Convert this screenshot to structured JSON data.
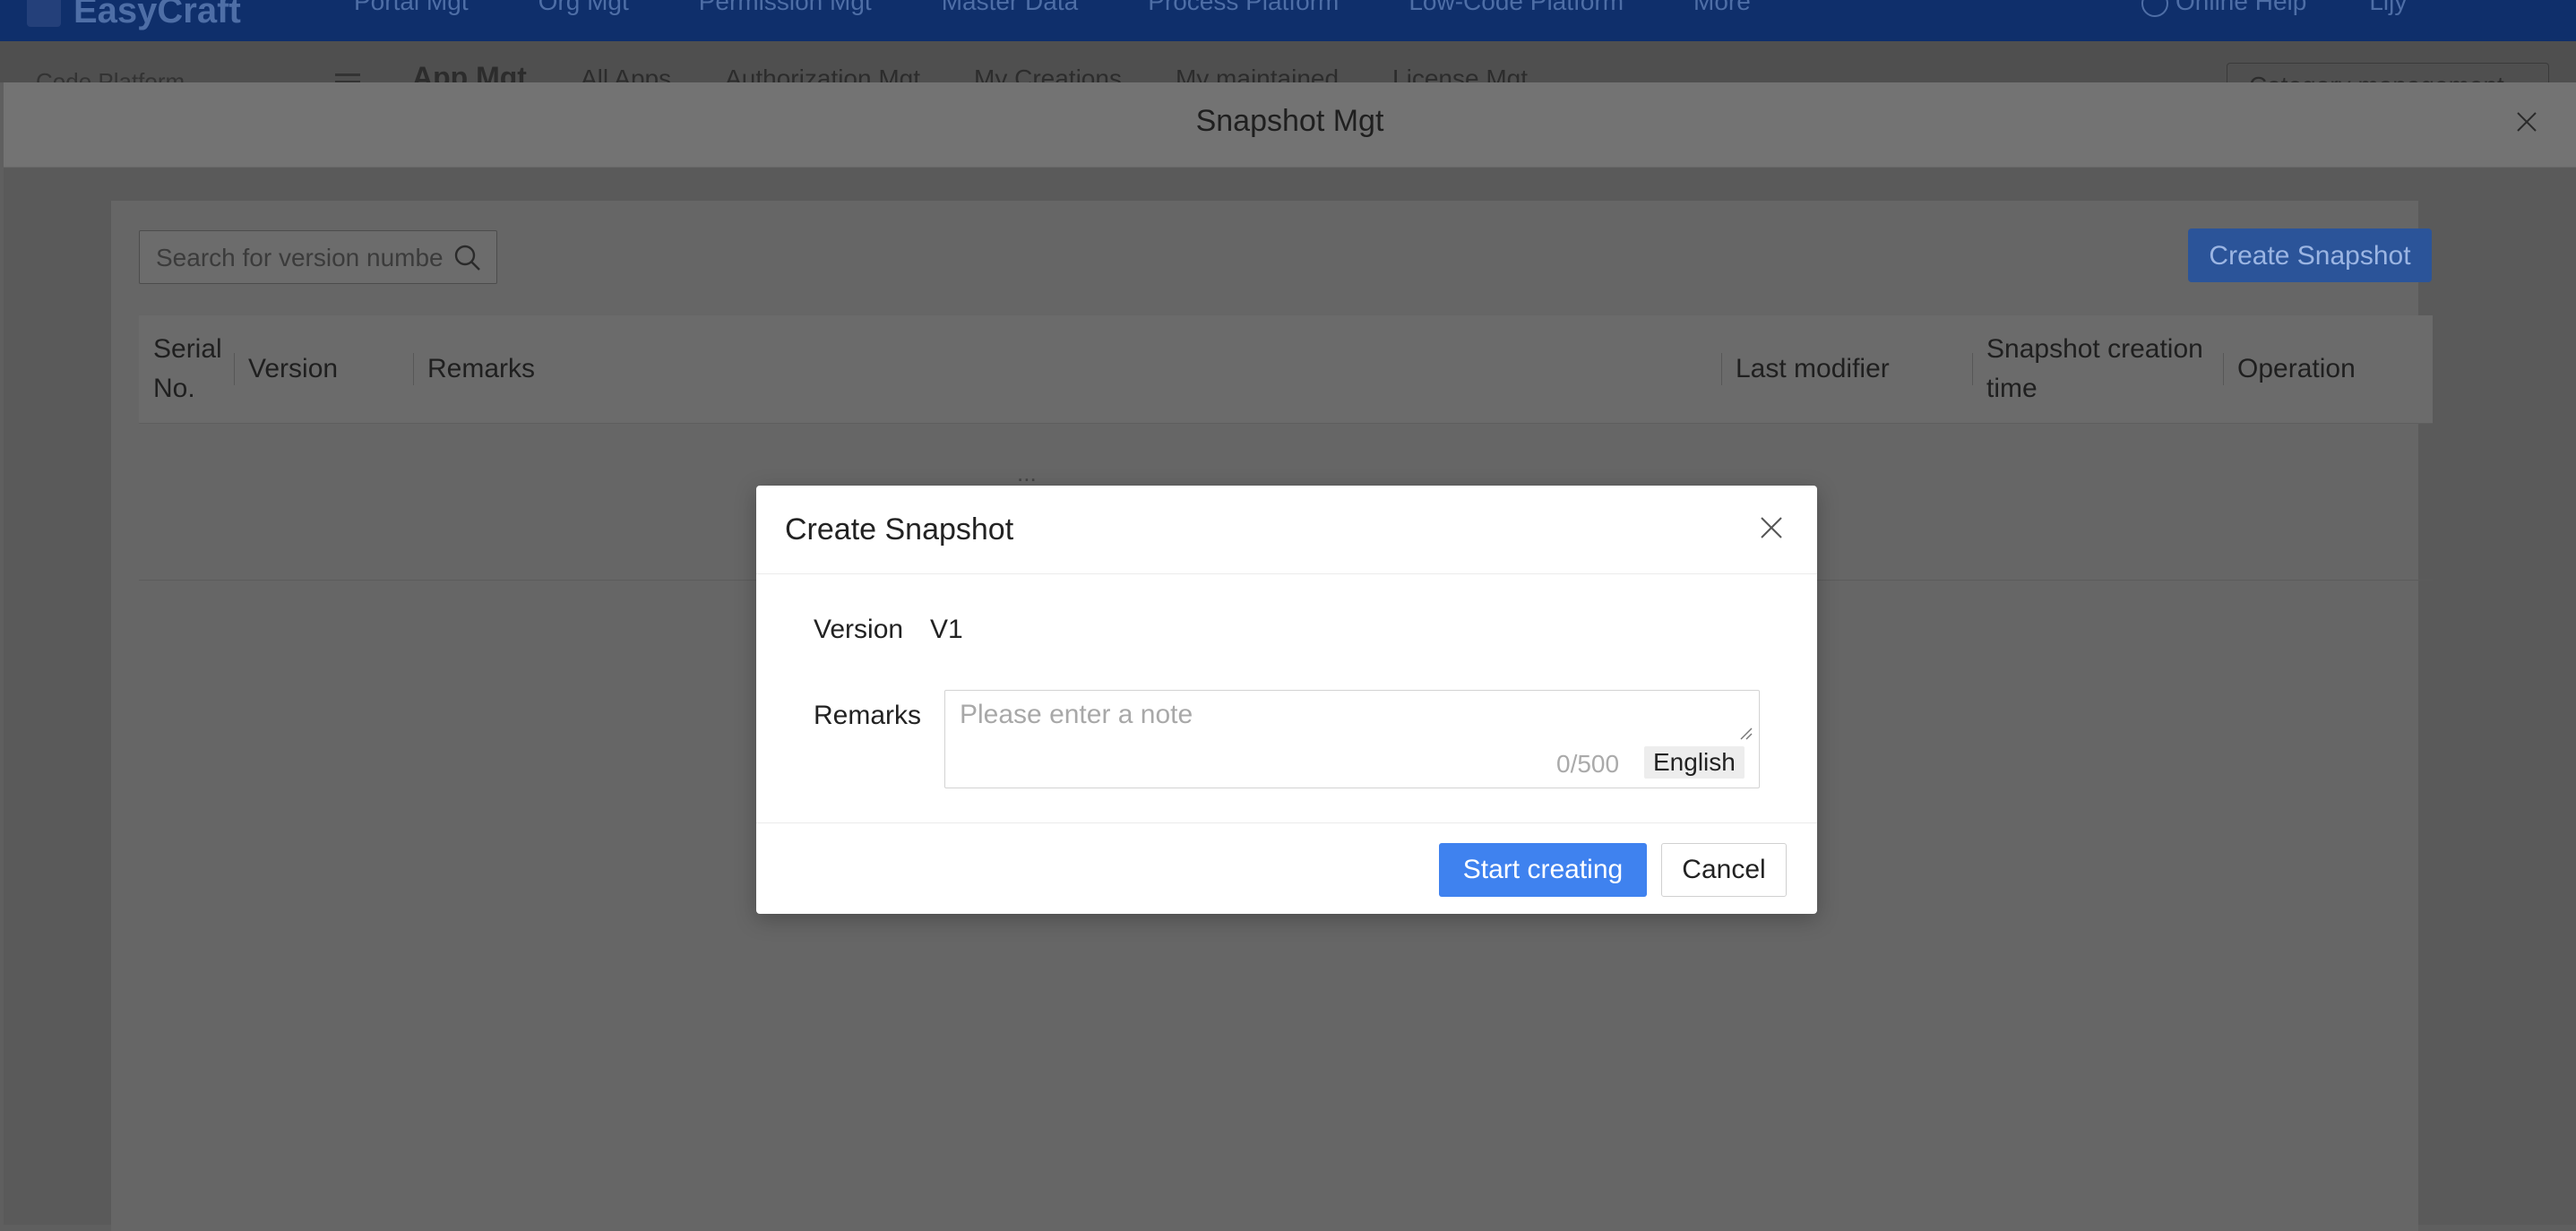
{
  "app": {
    "logo_text": "EasyCraft",
    "nav": [
      "Portal Mgt",
      "Org Mgt",
      "Permission Mgt",
      "Master Data",
      "Process Platform",
      "Low-Code Platform",
      "More"
    ],
    "online_help": "Online Help",
    "user": "Lijy",
    "subbar_left": "Code Platform",
    "tabs": [
      "App Mgt",
      "All Apps",
      "Authorization Mgt",
      "My Creations",
      "My maintained",
      "License Mgt"
    ],
    "category_button": "Category management"
  },
  "drawer": {
    "title": "Snapshot Mgt",
    "close_icon": "close-icon",
    "search_placeholder": "Search for version number",
    "search_icon": "search-icon",
    "create_button": "Create Snapshot",
    "columns": {
      "serial": "Serial No.",
      "version": "Version",
      "remarks": "Remarks",
      "last_modifier": "Last modifier",
      "creation_time": "Snapshot creation time",
      "operation": "Operation"
    },
    "empty_glyph": "..."
  },
  "modal": {
    "title": "Create Snapshot",
    "close_icon": "close-icon",
    "version_label": "Version",
    "version_value": "V1",
    "remarks_label": "Remarks",
    "remarks_placeholder": "Please enter a note",
    "remarks_value": "",
    "counter": "0/500",
    "language": "English",
    "start_button": "Start creating",
    "cancel_button": "Cancel",
    "colors": {
      "primary": "#3f82ef",
      "overlay": "#5f5f5f"
    }
  }
}
